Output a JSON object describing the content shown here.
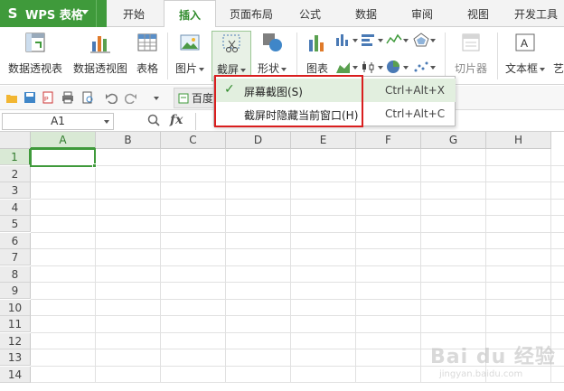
{
  "app": {
    "name": "WPS 表格",
    "logo": "S"
  },
  "tabs": [
    "开始",
    "插入",
    "页面布局",
    "公式",
    "数据",
    "审阅",
    "视图",
    "开发工具"
  ],
  "active_tab": "插入",
  "ribbon": {
    "pivot_table": "数据透视表",
    "pivot_chart": "数据透视图",
    "table": "表格",
    "picture": "图片",
    "screenshot": "截屏",
    "shapes": "形状",
    "chart": "图表",
    "slicer": "切片器",
    "textbox": "文本框",
    "art_partial": "艺"
  },
  "qat": {
    "baidu_tab": "百度"
  },
  "formula_bar": {
    "name_box": "A1",
    "fx": "fx"
  },
  "menu": {
    "items": [
      {
        "label": "屏幕截图(S)",
        "shortcut": "Ctrl+Alt+X",
        "checked": true
      },
      {
        "label": "截屏时隐藏当前窗口(H)",
        "shortcut": "Ctrl+Alt+C",
        "checked": false
      }
    ]
  },
  "columns": [
    "A",
    "B",
    "C",
    "D",
    "E",
    "F",
    "G",
    "H"
  ],
  "rows": [
    "1",
    "2",
    "3",
    "4",
    "5",
    "6",
    "7",
    "8",
    "9",
    "10",
    "11",
    "12",
    "13",
    "14"
  ],
  "watermark": {
    "brand": "Bai du 经验",
    "sub": "jingyan.baidu.com"
  },
  "colors": {
    "accent": "#3f9a3b",
    "highlight_box": "#d91e1e"
  }
}
